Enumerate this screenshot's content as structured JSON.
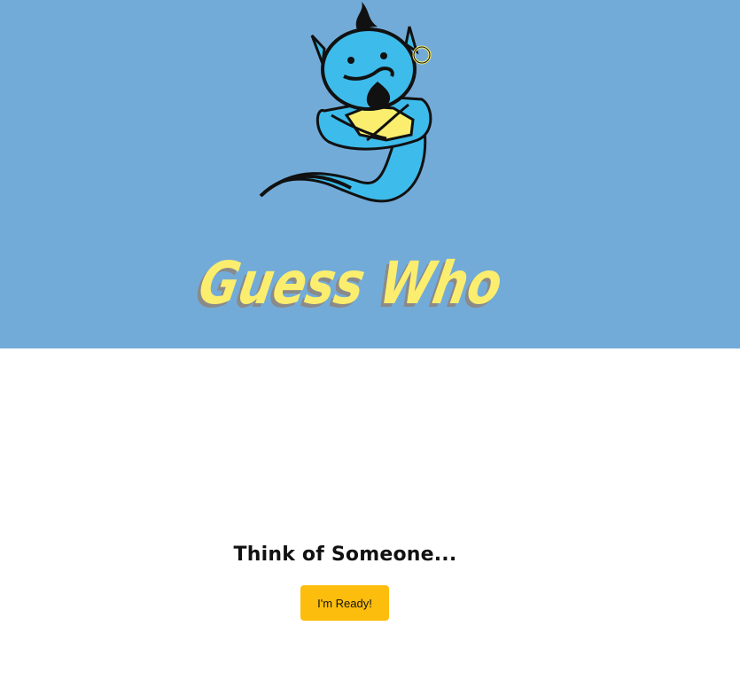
{
  "header": {
    "logo_text": "Guess Who"
  },
  "main": {
    "prompt": "Think of Someone...",
    "ready_button_label": "I'm Ready!"
  },
  "colors": {
    "hero_background": "#73abd8",
    "genie_body": "#3dbbea",
    "logo_text": "#fbee6e",
    "button": "#fdbd0d"
  },
  "icons": {
    "genie": "genie-mascot-icon"
  }
}
